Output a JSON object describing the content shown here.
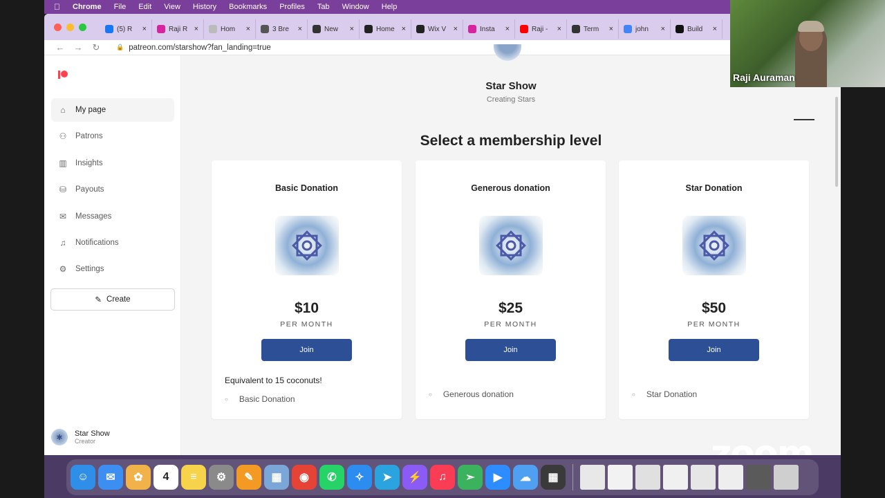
{
  "menubar": {
    "app": "Chrome",
    "items": [
      "File",
      "Edit",
      "View",
      "History",
      "Bookmarks",
      "Profiles",
      "Tab",
      "Window",
      "Help"
    ]
  },
  "tabs": [
    {
      "title": "(5) R",
      "icon": "facebook-icon",
      "color": "#1877f2"
    },
    {
      "title": "Raji R",
      "icon": "instagram-icon",
      "color": "#d6249f"
    },
    {
      "title": "Hom",
      "icon": "page-icon",
      "color": "#bbbbbb"
    },
    {
      "title": "3 Bre",
      "icon": "leaf-icon",
      "color": "#555555"
    },
    {
      "title": "New",
      "icon": "chrome-icon",
      "color": "#333333"
    },
    {
      "title": "Home",
      "icon": "wix-icon",
      "color": "#222222"
    },
    {
      "title": "Wix V",
      "icon": "wix-icon",
      "color": "#222222"
    },
    {
      "title": "Insta",
      "icon": "instagram-icon",
      "color": "#d6249f"
    },
    {
      "title": "Raji -",
      "icon": "youtube-icon",
      "color": "#ff0000"
    },
    {
      "title": "Term",
      "icon": "wikipedia-icon",
      "color": "#333333"
    },
    {
      "title": "john",
      "icon": "google-icon",
      "color": "#4285f4"
    },
    {
      "title": "Build",
      "icon": "patreon-icon",
      "color": "#111111"
    }
  ],
  "address": {
    "url": "patreon.com/starshow?fan_landing=true"
  },
  "sidebar": {
    "items": [
      {
        "label": "My page",
        "icon": "home-icon",
        "glyph": "⌂",
        "active": true
      },
      {
        "label": "Patrons",
        "icon": "users-icon",
        "glyph": "⚇",
        "active": false
      },
      {
        "label": "Insights",
        "icon": "bar-chart-icon",
        "glyph": "▥",
        "active": false
      },
      {
        "label": "Payouts",
        "icon": "wallet-icon",
        "glyph": "⛁",
        "active": false
      },
      {
        "label": "Messages",
        "icon": "mail-icon",
        "glyph": "✉",
        "active": false
      },
      {
        "label": "Notifications",
        "icon": "bell-icon",
        "glyph": "♫",
        "active": false
      },
      {
        "label": "Settings",
        "icon": "gear-icon",
        "glyph": "⚙",
        "active": false
      }
    ],
    "create_label": "Create",
    "profile_name": "Star Show",
    "profile_role": "Creator"
  },
  "creator": {
    "name": "Star Show",
    "tagline": "Creating Stars"
  },
  "section_title": "Select a membership level",
  "tiers": [
    {
      "title": "Basic Donation",
      "price": "$10",
      "period": "PER MONTH",
      "join": "Join",
      "description": "Equivalent to 15 coconuts!",
      "benefit": "Basic Donation"
    },
    {
      "title": "Generous donation",
      "price": "$25",
      "period": "PER MONTH",
      "join": "Join",
      "description": "",
      "benefit": "Generous donation"
    },
    {
      "title": "Star Donation",
      "price": "$50",
      "period": "PER MONTH",
      "join": "Join",
      "description": "",
      "benefit": "Star Donation"
    }
  ],
  "video": {
    "participant": "Raji Auraman"
  },
  "zoom_watermark": "zoom",
  "dock": {
    "apps": [
      {
        "name": "finder",
        "color": "#2f8ee8",
        "glyph": "☺"
      },
      {
        "name": "mail",
        "color": "#3c8ef0",
        "glyph": "✉"
      },
      {
        "name": "photos",
        "color": "#f2b24a",
        "glyph": "✿"
      },
      {
        "name": "calendar",
        "color": "#ffffff",
        "glyph": "4"
      },
      {
        "name": "notes",
        "color": "#f6d34a",
        "glyph": "≡"
      },
      {
        "name": "system-preferences",
        "color": "#8a8a8a",
        "glyph": "⚙"
      },
      {
        "name": "pages",
        "color": "#f39a24",
        "glyph": "✎"
      },
      {
        "name": "preview",
        "color": "#7aa6d8",
        "glyph": "▦"
      },
      {
        "name": "chrome",
        "color": "#e54335",
        "glyph": "◉"
      },
      {
        "name": "whatsapp",
        "color": "#25d366",
        "glyph": "✆"
      },
      {
        "name": "safari",
        "color": "#2d8cf0",
        "glyph": "✧"
      },
      {
        "name": "telegram",
        "color": "#2aa3df",
        "glyph": "➤"
      },
      {
        "name": "messenger",
        "color": "#8a5cf5",
        "glyph": "⚡"
      },
      {
        "name": "music",
        "color": "#fa3c55",
        "glyph": "♫"
      },
      {
        "name": "send",
        "color": "#3bb35e",
        "glyph": "➣"
      },
      {
        "name": "zoom",
        "color": "#2d8cff",
        "glyph": "▶"
      },
      {
        "name": "icloud",
        "color": "#4f9ff2",
        "glyph": "☁"
      },
      {
        "name": "calculator",
        "color": "#3a3a3a",
        "glyph": "▦"
      }
    ],
    "recent": [
      {
        "name": "document-1",
        "color": "#e8e8e8"
      },
      {
        "name": "document-2",
        "color": "#f2f2f2"
      },
      {
        "name": "document-3",
        "color": "#e0e0e0"
      },
      {
        "name": "document-4",
        "color": "#f0f0f0"
      },
      {
        "name": "document-5",
        "color": "#e6e6e6"
      },
      {
        "name": "document-6",
        "color": "#eeeeee"
      },
      {
        "name": "calculator-doc",
        "color": "#5a5a5a"
      },
      {
        "name": "trash",
        "color": "#cfcfcf"
      }
    ]
  }
}
